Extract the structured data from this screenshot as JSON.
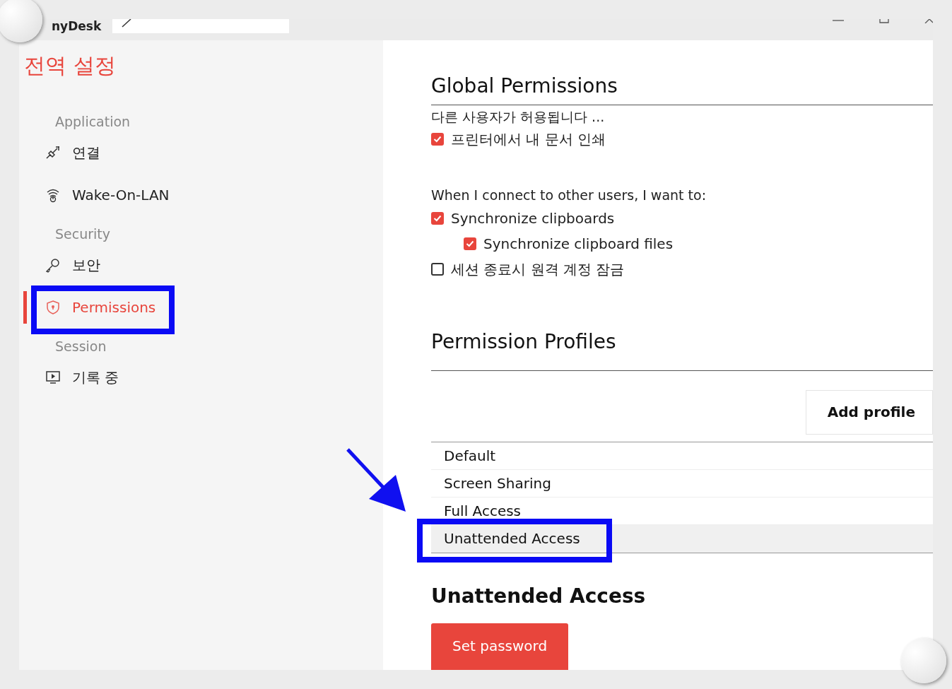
{
  "window": {
    "title": "nyDesk"
  },
  "sidebar": {
    "title": "전역 설정",
    "sections": [
      {
        "heading": "Application",
        "items": [
          {
            "label": "연결",
            "selected": false
          },
          {
            "label": "Wake-On-LAN",
            "selected": false
          }
        ]
      },
      {
        "heading": "Security",
        "items": [
          {
            "label": "보안",
            "selected": false
          },
          {
            "label": "Permissions",
            "selected": true
          }
        ]
      },
      {
        "heading": "Session",
        "items": [
          {
            "label": "기록 중",
            "selected": false
          }
        ]
      }
    ]
  },
  "global_permissions": {
    "title": "Global Permissions",
    "subtitle": "다른 사용자가 허용됩니다 ...",
    "options": [
      {
        "label": "프린터에서 내 문서 인쇄",
        "checked": true
      }
    ]
  },
  "connect_options": {
    "heading": "When I connect to other users, I want to:",
    "options": [
      {
        "label": "Synchronize clipboards",
        "checked": true,
        "children": [
          {
            "label": "Synchronize clipboard files",
            "checked": true
          }
        ]
      },
      {
        "label": "세션 종료시 원격 계정 잠금",
        "checked": false
      }
    ]
  },
  "permission_profiles": {
    "title": "Permission Profiles",
    "add_button": "Add profile",
    "profiles": [
      {
        "name": "Default",
        "selected": false
      },
      {
        "name": "Screen Sharing",
        "selected": false
      },
      {
        "name": "Full Access",
        "selected": false
      },
      {
        "name": "Unattended Access",
        "selected": true
      }
    ]
  },
  "unattended_access": {
    "title": "Unattended Access",
    "button": "Set password"
  }
}
